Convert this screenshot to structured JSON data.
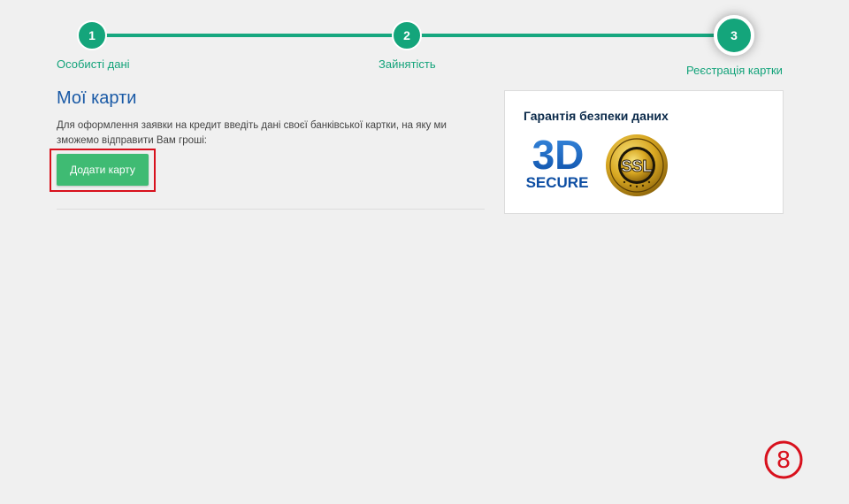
{
  "stepper": {
    "steps": [
      {
        "number": "1",
        "label": "Особисті дані"
      },
      {
        "number": "2",
        "label": "Зайнятість"
      },
      {
        "number": "3",
        "label": "Реєстрація картки"
      }
    ],
    "active_step": 3,
    "accent_color": "#16a77f"
  },
  "cards": {
    "title": "Мої карти",
    "description": "Для оформлення заявки на кредит введіть дані своєї банківської картки, на яку ми зможемо відправити Вам гроші:",
    "add_button_label": "Додати карту",
    "button_color": "#3fbb73"
  },
  "security": {
    "title": "Гарантія безпеки даних",
    "logo_3d_main": "3D",
    "logo_3d_sub": "SECURE",
    "logo_ssl": "SSL"
  },
  "annotation": {
    "step_number": "8",
    "highlight_color": "#d8111d"
  }
}
